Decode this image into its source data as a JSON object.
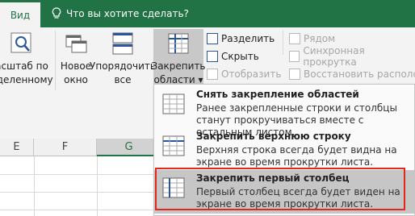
{
  "tabs": {
    "active": "Вид"
  },
  "tell_me": {
    "text": "Что вы хотите сделать?"
  },
  "ribbon": {
    "zoom_selection": {
      "line1": "асштаб по",
      "line2": "еделенному"
    },
    "new_window": {
      "line1": "Новое",
      "line2": "окно"
    },
    "arrange_all": {
      "line1": "Упорядочить",
      "line2": "все"
    },
    "freeze_panes": {
      "line1": "Закрепить",
      "line2": "области ▾"
    },
    "split": "Разделить",
    "hide": "Скрыть",
    "unhide": "Отобразить",
    "view_side_by_side": "Рядом",
    "sync_scroll": "Синхронная прокрутка",
    "reset_position": "Восстановить располож"
  },
  "columns": [
    "E",
    "F",
    "G"
  ],
  "menu": {
    "items": [
      {
        "title": "Снять закрепление областей",
        "desc": "Ранее закрепленные строки и столбцы станут прокручиваться вместе с остальным листом."
      },
      {
        "title": "Закрепить верхнюю строку",
        "desc": "Верхняя строка всегда будет видна на экране во время прокрутки листа."
      },
      {
        "title": "Закрепить первый столбец",
        "desc": "Первый столбец всегда будет виден на экране во время прокрутки листа."
      }
    ]
  },
  "colors": {
    "accent": "#217346",
    "highlight_border": "#e0281c",
    "icon_blue": "#2b579a"
  }
}
